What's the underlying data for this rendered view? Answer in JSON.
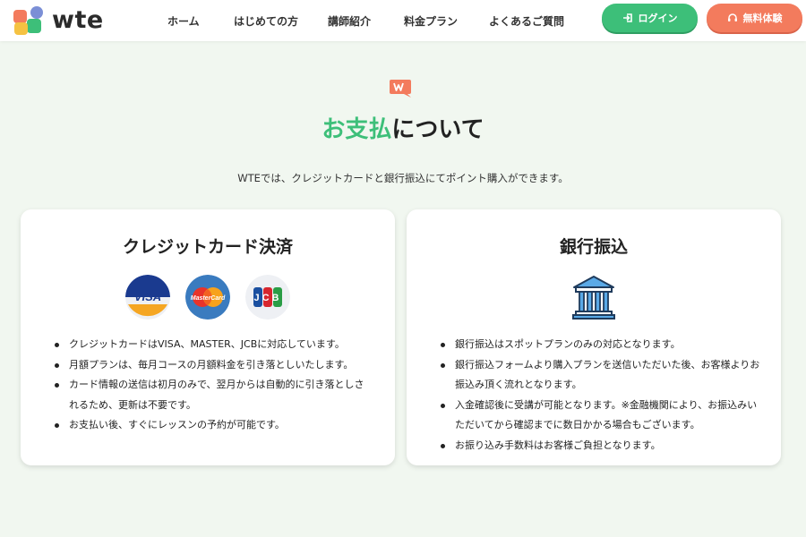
{
  "header": {
    "logo_text": "wte",
    "nav": [
      {
        "label": "ホーム"
      },
      {
        "label": "はじめての方"
      },
      {
        "label": "講師紹介"
      },
      {
        "label": "料金プラン"
      },
      {
        "label": "よくあるご質問"
      }
    ],
    "login_label": "ログイン",
    "trial_label": "無料体験",
    "colors": {
      "login": "#3dbf79",
      "trial": "#f37b5d"
    }
  },
  "hero": {
    "badge_icon": "w-speech-bubble-icon",
    "title_accent": "お支払",
    "title_rest": "について",
    "subtitle": "WTEでは、クレジットカードと銀行振込にてポイント購入ができます。"
  },
  "credit": {
    "title": "クレジットカード決済",
    "logos": [
      {
        "name": "visa",
        "label": "VISA"
      },
      {
        "name": "mastercard",
        "label": "MasterCard"
      },
      {
        "name": "jcb",
        "label": "JCB"
      }
    ],
    "items": [
      "クレジットカードはVISA、MASTER、JCBに対応しています。",
      "月額プランは、毎月コースの月額料金を引き落としいたします。",
      "カード情報の送信は初月のみで、翌月からは自動的に引き落としされるため、更新は不要です。",
      "お支払い後、すぐにレッスンの予約が可能です。"
    ]
  },
  "bank": {
    "title": "銀行振込",
    "icon": "bank-building-icon",
    "items": [
      "銀行振込はスポットプランのみの対応となります。",
      "銀行振込フォームより購入プランを送信いただいた後、お客様よりお振込み頂く流れとなります。",
      "入金確認後に受講が可能となります。※金融機関により、お振込みいただいてから確認までに数日かかる場合もございます。",
      "お振り込み手数料はお客様ご負担となります。"
    ]
  }
}
